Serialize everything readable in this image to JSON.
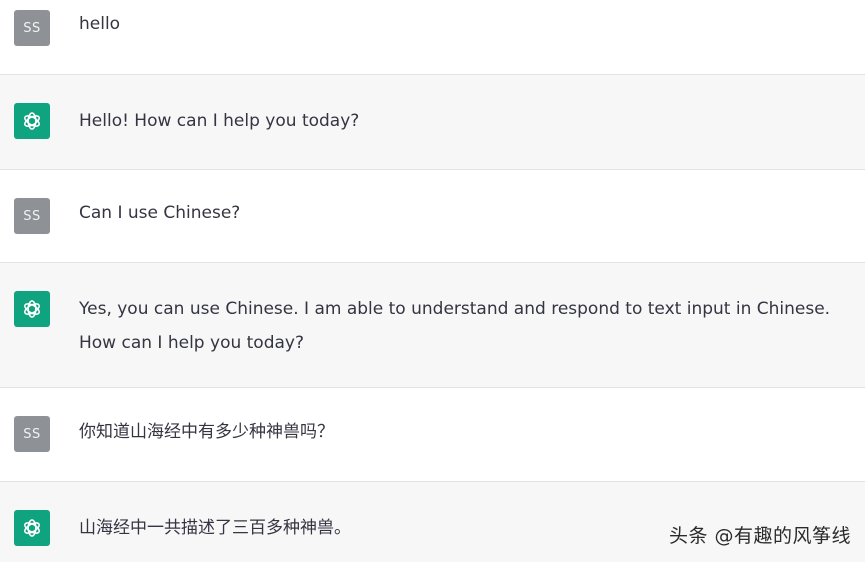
{
  "user": {
    "avatar_initials": "SS"
  },
  "assistant": {
    "avatar_icon": "openai-logo-icon"
  },
  "colors": {
    "assistant_avatar_bg": "#10a37f",
    "user_avatar_bg": "#8e9296",
    "assistant_row_bg": "#f7f7f8",
    "user_row_bg": "#ffffff"
  },
  "messages": [
    {
      "role": "user",
      "text": "hello"
    },
    {
      "role": "assistant",
      "text": "Hello! How can I help you today?"
    },
    {
      "role": "user",
      "text": "Can I use Chinese?"
    },
    {
      "role": "assistant",
      "text": "Yes, you can use Chinese. I am able to understand and respond to text input in Chinese. How can I help you today?"
    },
    {
      "role": "user",
      "text": "你知道山海经中有多少种神兽吗？"
    },
    {
      "role": "assistant",
      "text": "山海经中一共描述了三百多种神兽。"
    }
  ],
  "watermark": "头条 @有趣的风筝线"
}
